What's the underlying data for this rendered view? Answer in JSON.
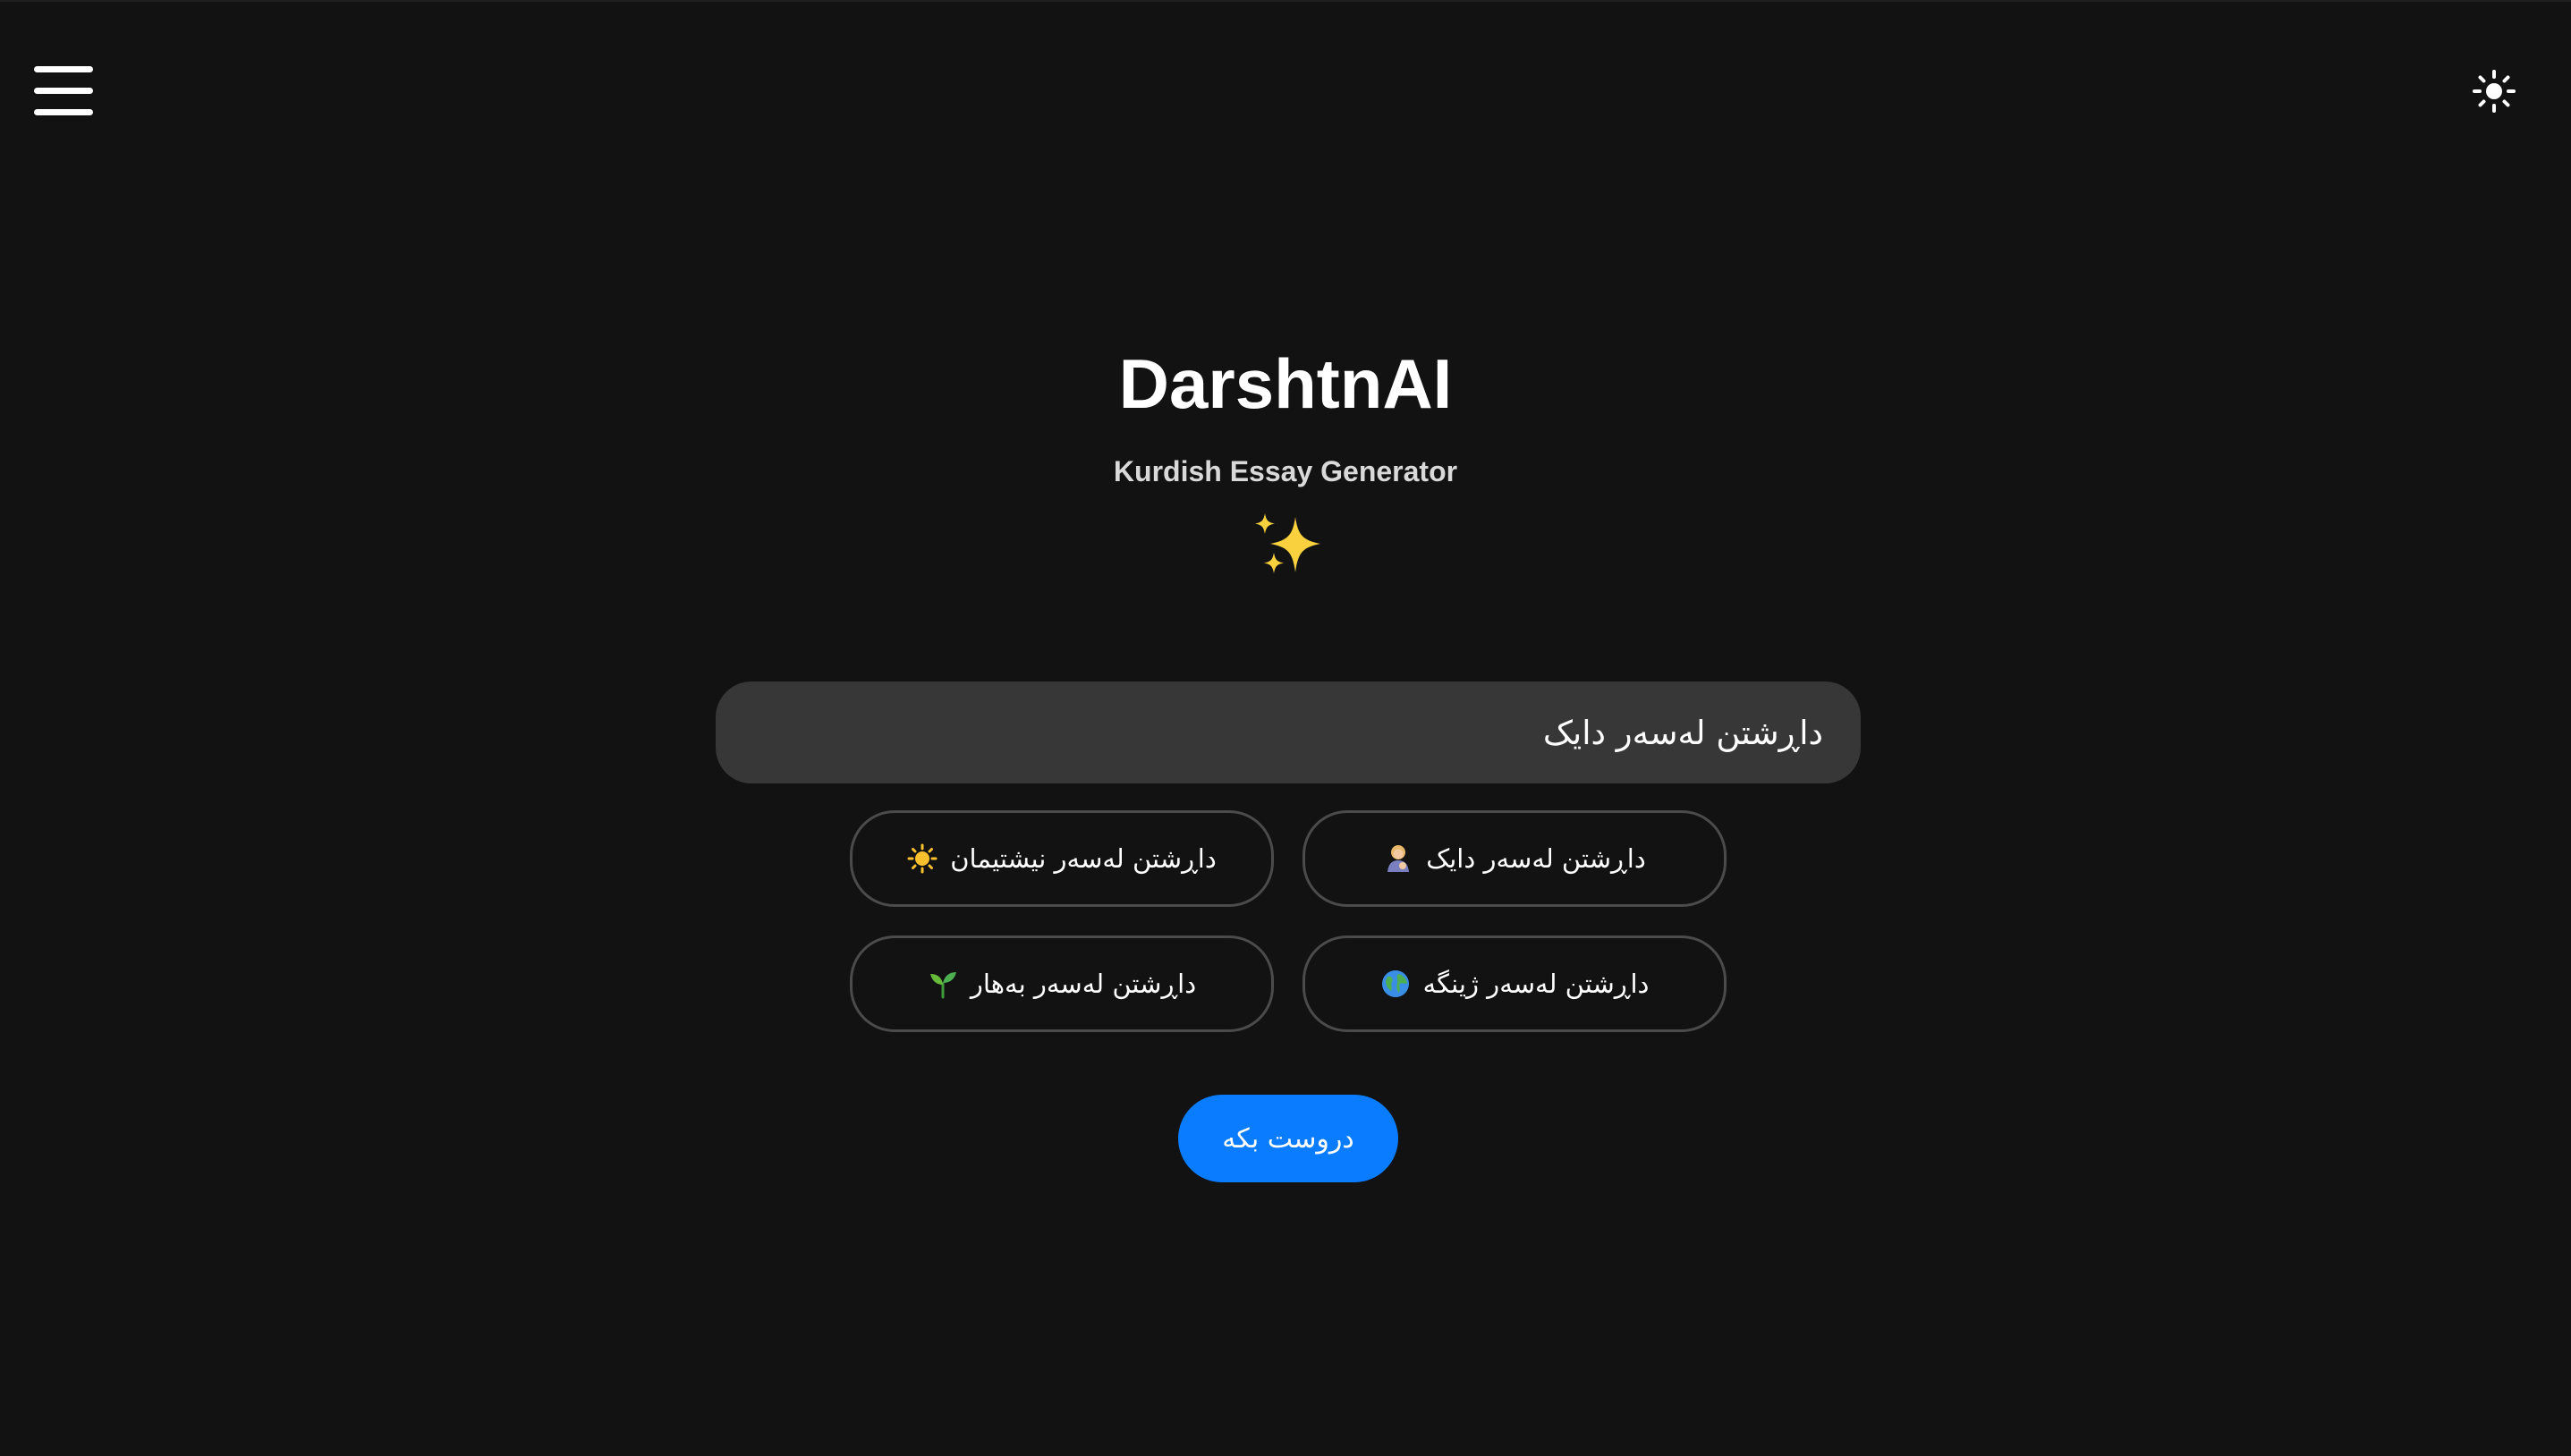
{
  "header": {
    "menu_icon": "hamburger-menu-icon",
    "theme_icon": "sun-icon"
  },
  "hero": {
    "title": "DarshtnAI",
    "subtitle": "Kurdish Essay Generator",
    "decoration_icon": "sparkles-icon"
  },
  "topic_input": {
    "value": "داڕشتن لەسەر دایک"
  },
  "suggestions": [
    {
      "label": "داڕشتن لەسەر دایک",
      "icon": "mother-emoji-icon"
    },
    {
      "label": "داڕشتن لەسەر نیشتیمان",
      "icon": "sun-emoji-icon"
    },
    {
      "label": "داڕشتن لەسەر ژینگە",
      "icon": "globe-emoji-icon"
    },
    {
      "label": "داڕشتن لەسەر بەهار",
      "icon": "seedling-emoji-icon"
    }
  ],
  "generate_button": {
    "label": "دروست بکە",
    "color": "#0a7cff"
  },
  "colors": {
    "background": "#121212",
    "input_background": "#373737",
    "chip_border": "#4b4b4b",
    "sparkle": "#f9d13e"
  }
}
